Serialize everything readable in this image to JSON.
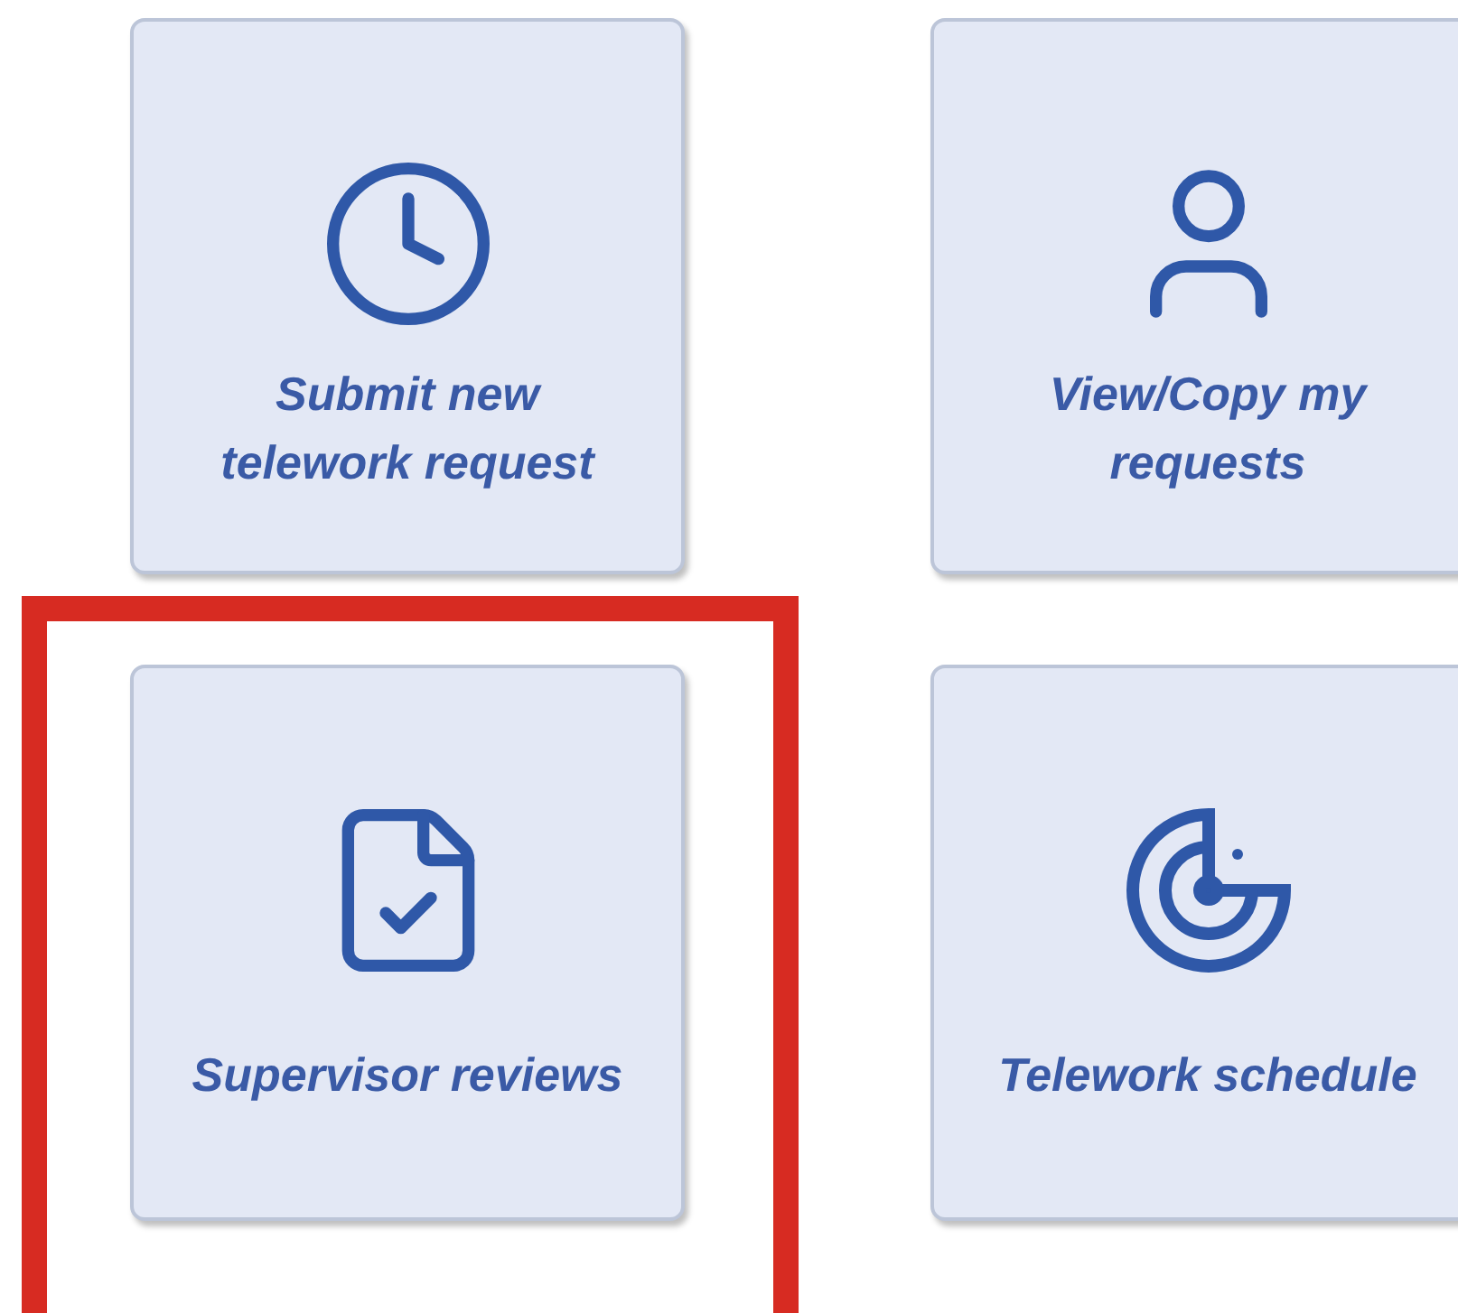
{
  "tiles": [
    {
      "kind": "clock",
      "label": "Submit new telework request",
      "highlighted": false
    },
    {
      "kind": "person",
      "label": "View/Copy my requests",
      "highlighted": false
    },
    {
      "kind": "document",
      "label": "Supervisor reviews",
      "highlighted": true
    },
    {
      "kind": "radar",
      "label": "Telework schedule",
      "highlighted": false
    }
  ]
}
